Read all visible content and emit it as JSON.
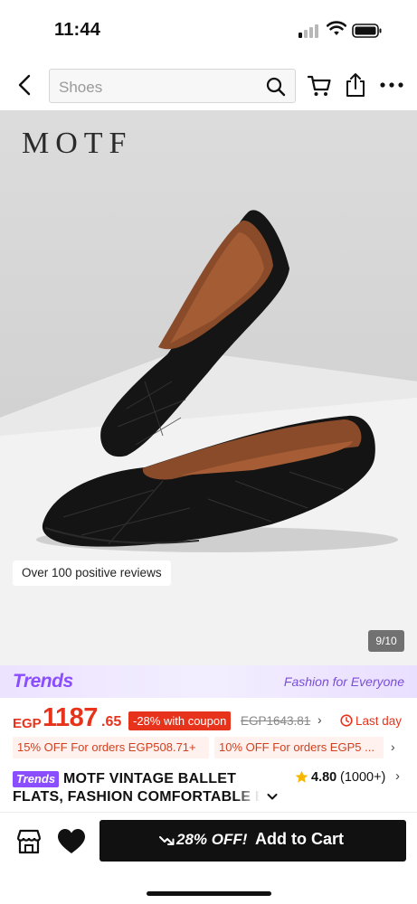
{
  "status_bar": {
    "time": "11:44"
  },
  "header": {
    "search_placeholder": "Shoes",
    "icons": [
      "back-arrow-icon",
      "search-icon",
      "cart-icon",
      "share-icon",
      "more-icon"
    ]
  },
  "gallery": {
    "brand_logo": "MOTF",
    "reviews_badge": "Over 100 positive reviews",
    "counter": "9/10"
  },
  "trends_banner": {
    "logo": "Trends",
    "tagline": "Fashion for Everyone",
    "color": "#8a4dff"
  },
  "price": {
    "currency": "EGP",
    "integer": "1187",
    "decimal": ".65",
    "discount_badge": "-28% with coupon",
    "original_price": "EGP1643.81",
    "original_chevron": "›",
    "deadline": "Last day",
    "color": "#e8331c"
  },
  "coupons": [
    {
      "label": "15% OFF For orders EGP508.71+"
    },
    {
      "label": "10% OFF For orders EGP5 ..."
    }
  ],
  "coupons_chevron": "›",
  "product": {
    "tag": "Trends",
    "title_line1": "MOTF VINTAGE BALLET",
    "title_line2": "FLATS, FASHION COMFORTABLE B",
    "rating": "4.80",
    "rating_count": "(1000+)",
    "rating_chevron": "›"
  },
  "bottom_bar": {
    "icons": [
      "store-icon",
      "heart-icon"
    ],
    "cart_discount": "28% OFF!",
    "cart_label": "Add to Cart"
  }
}
